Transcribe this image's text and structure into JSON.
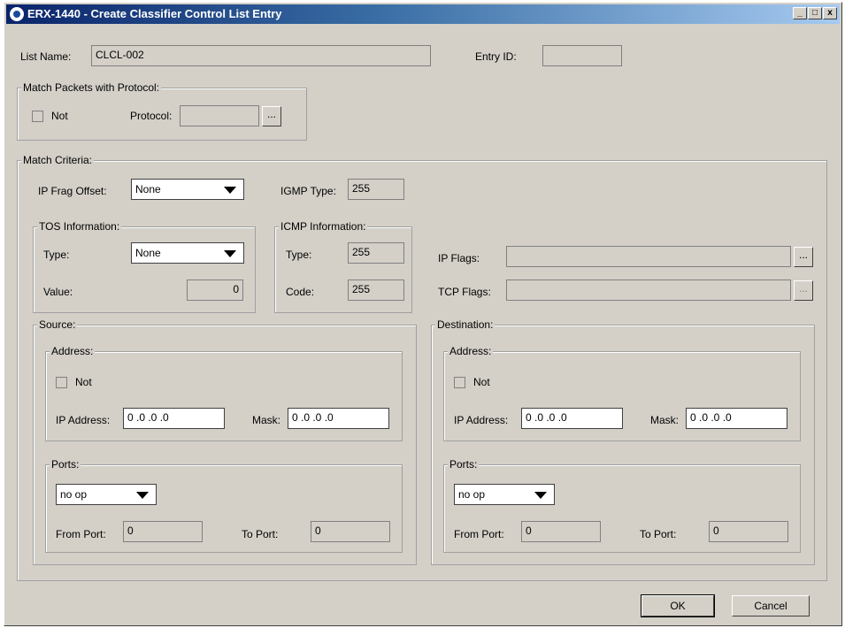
{
  "window": {
    "title": "ERX-1440 - Create Classifier Control List Entry",
    "minimize_glyph": "_",
    "maximize_glyph": "□",
    "close_glyph": "x"
  },
  "list_name": {
    "label": "List Name:",
    "value": "CLCL-002"
  },
  "entry_id": {
    "label": "Entry ID:",
    "value": ""
  },
  "protocol_group": {
    "title": "Match Packets with Protocol:",
    "not_label": "Not",
    "protocol_label": "Protocol:",
    "protocol_value": "",
    "browse_label": "..."
  },
  "match_criteria": {
    "title": "Match Criteria:",
    "ip_frag_offset": {
      "label": "IP Frag Offset:",
      "value": "None"
    },
    "igmp_type": {
      "label": "IGMP Type:",
      "value": "255"
    },
    "tos": {
      "title": "TOS Information:",
      "type_label": "Type:",
      "type_value": "None",
      "value_label": "Value:",
      "value": "0"
    },
    "icmp": {
      "title": "ICMP Information:",
      "type_label": "Type:",
      "type_value": "255",
      "code_label": "Code:",
      "code_value": "255"
    },
    "ip_flags": {
      "label": "IP Flags:",
      "value": "",
      "browse_label": "..."
    },
    "tcp_flags": {
      "label": "TCP Flags:",
      "value": "",
      "browse_label": "..."
    },
    "source": {
      "title": "Source:",
      "address_title": "Address:",
      "not_label": "Not",
      "ip_label": "IP Address:",
      "ip_value": "0 .0 .0 .0",
      "mask_label": "Mask:",
      "mask_value": "0 .0 .0 .0",
      "ports_title": "Ports:",
      "ports_op": "no op",
      "from_label": "From Port:",
      "from_value": "0",
      "to_label": "To Port:",
      "to_value": "0"
    },
    "destination": {
      "title": "Destination:",
      "address_title": "Address:",
      "not_label": "Not",
      "ip_label": "IP Address:",
      "ip_value": "0 .0 .0 .0",
      "mask_label": "Mask:",
      "mask_value": "0 .0 .0 .0",
      "ports_title": "Ports:",
      "ports_op": "no op",
      "from_label": "From Port:",
      "from_value": "0",
      "to_label": "To Port:",
      "to_value": "0"
    }
  },
  "buttons": {
    "ok": "OK",
    "cancel": "Cancel"
  }
}
